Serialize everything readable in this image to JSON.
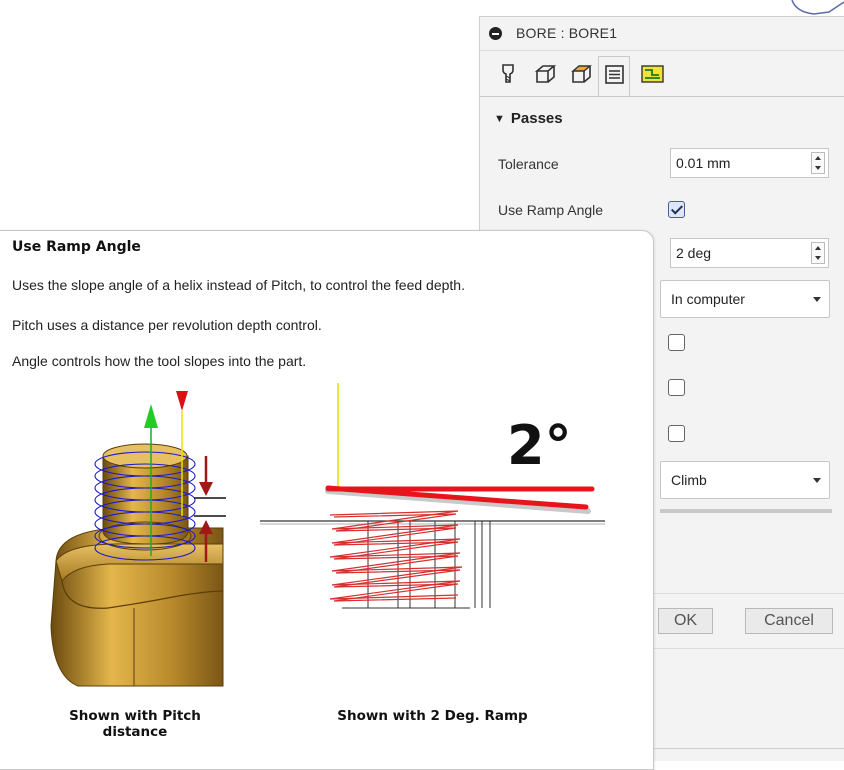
{
  "dialog": {
    "title": "BORE : BORE1",
    "tabs": [
      {
        "icon": "tool-icon",
        "active": false
      },
      {
        "icon": "geometry-icon",
        "active": false
      },
      {
        "icon": "heights-icon",
        "active": false
      },
      {
        "icon": "passes-icon",
        "active": true
      },
      {
        "icon": "linking-icon",
        "active": false
      }
    ],
    "section_title": "Passes",
    "tolerance_label": "Tolerance",
    "tolerance_value": "0.01 mm",
    "use_ramp_angle_label": "Use Ramp Angle",
    "use_ramp_angle_checked": true,
    "ramp_angle_value": "2 deg",
    "compensation_value": "In computer",
    "checkboxes": [
      false,
      false,
      false
    ],
    "direction_value": "Climb",
    "ok_label": "OK",
    "cancel_label": "Cancel"
  },
  "tooltip": {
    "title": "Use Ramp Angle",
    "line1": "Uses the slope angle of a helix instead of Pitch, to control the feed depth.",
    "line2": "Pitch uses a distance per revolution depth control.",
    "line3": "Angle controls how the tool slopes into the part.",
    "angle_label": "2°",
    "caption_left_line1": "Shown with Pitch",
    "caption_left_line2": "distance",
    "caption_right": "Shown with 2 Deg. Ramp"
  },
  "colors": {
    "accent_red": "#e8141c",
    "helix_blue": "#1a1acc",
    "part_gold": "#b8862a"
  }
}
